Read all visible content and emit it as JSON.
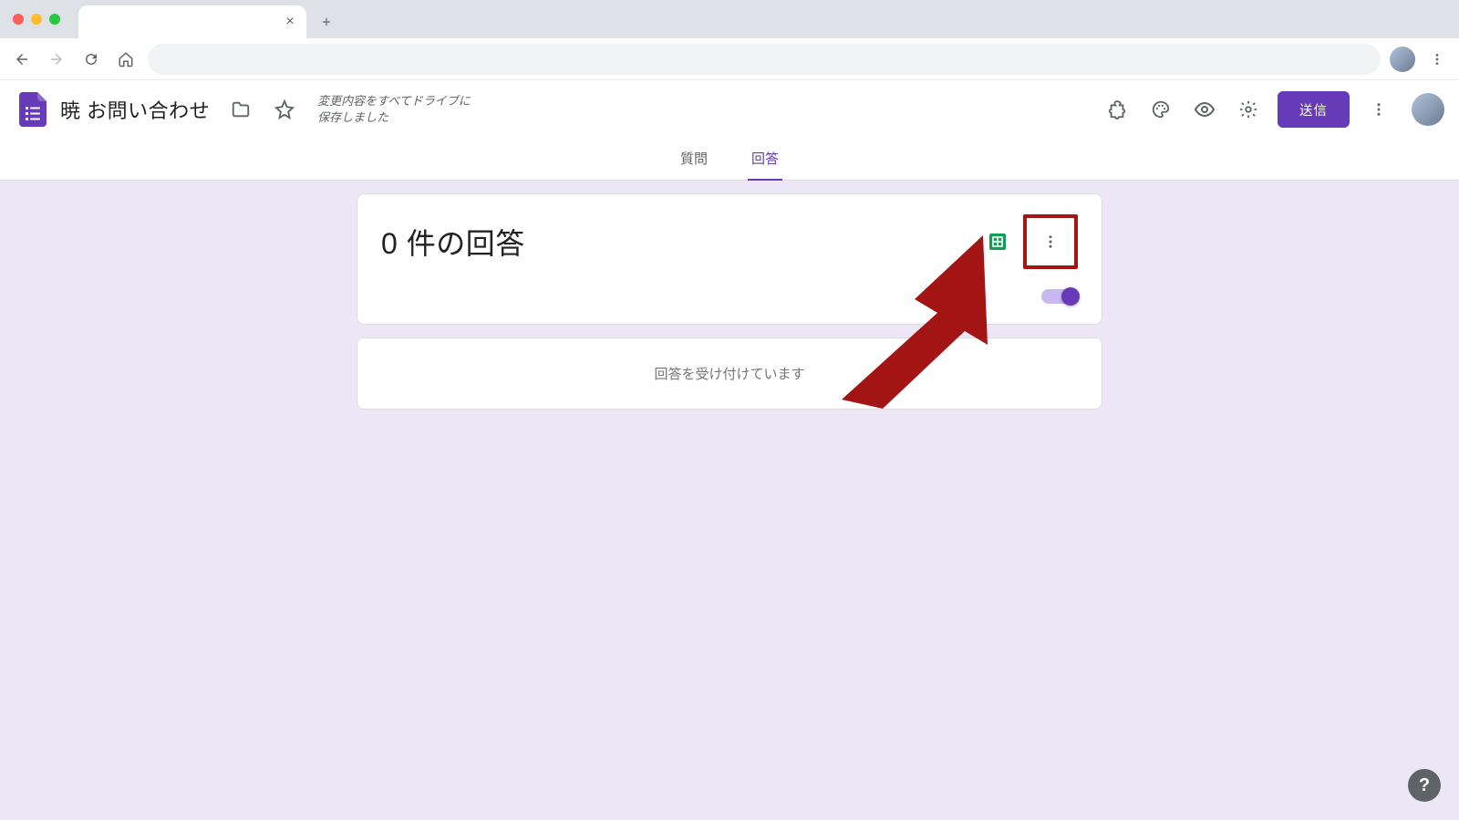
{
  "browser": {
    "tab_title": "",
    "url": ""
  },
  "header": {
    "form_title": "暁 お問い合わせ",
    "save_status_line1": "変更内容をすべてドライブに",
    "save_status_line2": "保存しました",
    "send_label": "送信"
  },
  "tabs": {
    "questions": "質問",
    "responses": "回答",
    "active": "responses"
  },
  "responses": {
    "count_label": "0 件の回答",
    "accepting_label": "回答を受け付けています",
    "accepting_toggle": true
  },
  "colors": {
    "accent": "#673ab7",
    "highlight": "#a31515",
    "sheets_green": "#0f9d58"
  },
  "icons": {
    "folder": "folder-icon",
    "star": "star-icon",
    "addons": "puzzle-icon",
    "theme": "palette-icon",
    "preview": "eye-icon",
    "settings": "gear-icon",
    "more": "more-vert-icon",
    "sheets": "sheets-icon"
  }
}
